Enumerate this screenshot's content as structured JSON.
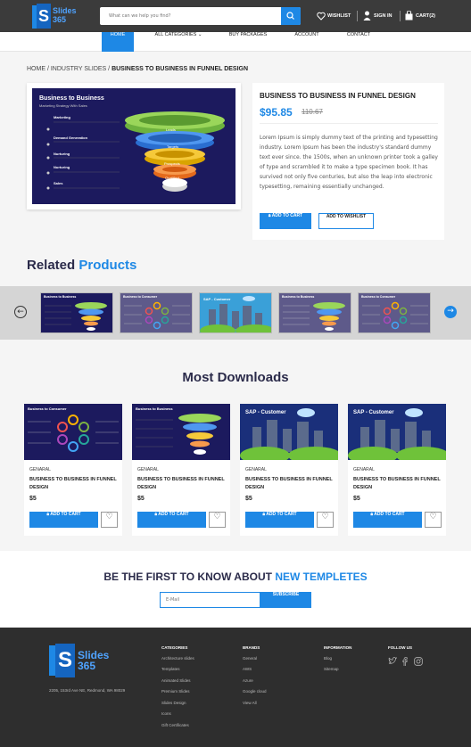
{
  "header": {
    "brand_line1": "Slides",
    "brand_line2": "365",
    "search_placeholder": "What can we help you find?",
    "wishlist": "WISHLIST",
    "signin": "SIGN IN",
    "cart": "CART(2)"
  },
  "nav": [
    "HOME",
    "ALL CATEGORIES",
    "BUY PACKAGES",
    "ACCOUNT",
    "CONTACT"
  ],
  "breadcrumb": {
    "home": "HOME",
    "sep": " / ",
    "cat": "INDUSTRY SLIDES",
    "current": "BUSINESS TO BUSINESS IN FUNNEL DESIGN"
  },
  "slide": {
    "title": "Business to Business",
    "subtitle": "Marketing Strategy With Sales",
    "items": [
      "Marketing",
      "Demand Generation",
      "Nurturing",
      "Nurturing",
      "Sales"
    ],
    "funnel": [
      "Leads",
      "Targets",
      "Prospects",
      "Qualified",
      ""
    ]
  },
  "product": {
    "title": "BUSINESS TO BUSINESS IN FUNNEL DESIGN",
    "price": "$95.85",
    "old_price": "110.67",
    "description": "Lorem Ipsum is simply dummy text of the printing and typesetting industry. Lorem Ipsum has been the industry's standard dummy text ever since. the 1500s, when an unknown printer took a galley of type and scrambled it to make a type specimen book. It has survived not only five centuries, but also the leap into electronic typesetting, remaining essentially unchanged.",
    "add_to_cart": "ADD TO CART",
    "add_to_wishlist": "ADD TO WISHLIST"
  },
  "related": {
    "title_a": "Related",
    "title_b": "Products",
    "thumbs": [
      "Business to Business",
      "Business to Consumer",
      "SAP - Customer",
      "Business to Business",
      "Business to Consumer"
    ]
  },
  "downloads": {
    "title": "Most Downloads",
    "cards": [
      {
        "img": "Business to Consumer",
        "category": "GENARAL",
        "title": "BUSINESS TO BUSINESS IN FUNNEL DESIGN",
        "price": "$5",
        "button": "ADD TO CART"
      },
      {
        "img": "Business to Business",
        "category": "GENARAL",
        "title": "BUSINESS TO BUSINESS IN FUNNEL DESIGN",
        "price": "$5",
        "button": "ADD TO CART"
      },
      {
        "img": "SAP - Customer",
        "category": "GENARAL",
        "title": "BUSINESS TO BUSINESS IN FUNNEL DESIGN",
        "price": "$5",
        "button": "ADD TO CART"
      },
      {
        "img": "SAP - Customer",
        "category": "GENARAL",
        "title": "BUSINESS TO BUSINESS IN FUNNEL DESIGN",
        "price": "$5",
        "button": "ADD TO CART"
      }
    ]
  },
  "newsletter": {
    "title_a": "BE THE FIRST TO KNOW ABOUT",
    "title_b": "NEW TEMPLETES",
    "placeholder": "E-Mail",
    "button": "SUBSCRIBE"
  },
  "footer": {
    "address": "2205, 153rd Ave NE, Redmond, WA 98029",
    "categories": {
      "heading": "CATEGORIES",
      "items": [
        "Architecture slides",
        "Templates",
        "Animated Slides",
        "Premium Slides",
        "Slides Design",
        "Icons",
        "Gift Certificates"
      ]
    },
    "brands": {
      "heading": "BRANDS",
      "items": [
        "General",
        "AWS",
        "Azure",
        "Google cloud",
        "View All"
      ]
    },
    "information": {
      "heading": "INFORMATION",
      "items": [
        "Blog",
        "Sitemap"
      ]
    },
    "follow": {
      "heading": "FOLLOW US",
      "icons": [
        "twitter-icon",
        "facebook-icon",
        "instagram-icon"
      ]
    }
  },
  "colors": {
    "accent": "#1e88e5",
    "header": "#3b3b3b",
    "footer": "#2e2e2e",
    "slide_bg": "#1c1a5e"
  }
}
